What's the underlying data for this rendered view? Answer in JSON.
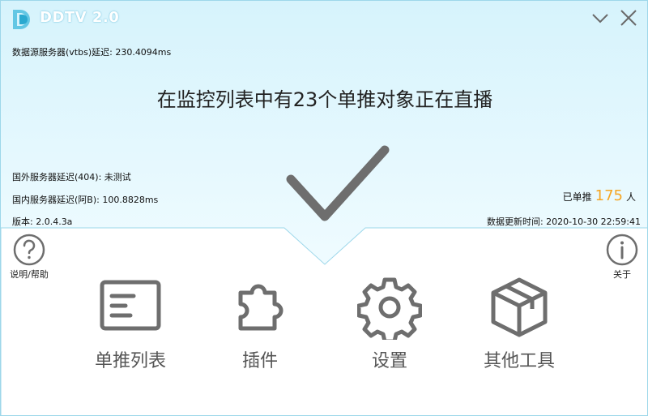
{
  "app": {
    "title": "DDTV 2.0"
  },
  "status": {
    "data_source_latency_label": "数据源服务器(vtbs)延迟: 230.4094ms",
    "headline": "在监控列表中有23个单推对象正在直播",
    "overseas_latency_label": "国外服务器延迟(404): 未测试",
    "domestic_latency_label": "国内服务器延迟(阿B): 100.8828ms",
    "version_label": "版本: 2.0.4.3a",
    "pushed_prefix": "已单推",
    "pushed_count": "175",
    "pushed_suffix": "人",
    "data_update_time_label": "数据更新时间: 2020-10-30 22:59:41"
  },
  "buttons": {
    "help_label": "说明/帮助",
    "about_label": "关于"
  },
  "tiles": [
    {
      "label": "单推列表",
      "icon": "list-card-icon"
    },
    {
      "label": "插件",
      "icon": "puzzle-piece-icon"
    },
    {
      "label": "设置",
      "icon": "gear-icon"
    },
    {
      "label": "其他工具",
      "icon": "box-icon"
    }
  ],
  "colors": {
    "accent": "#7fcbe3",
    "count": "#f6a623",
    "icon_gray": "#6e6e6e"
  }
}
